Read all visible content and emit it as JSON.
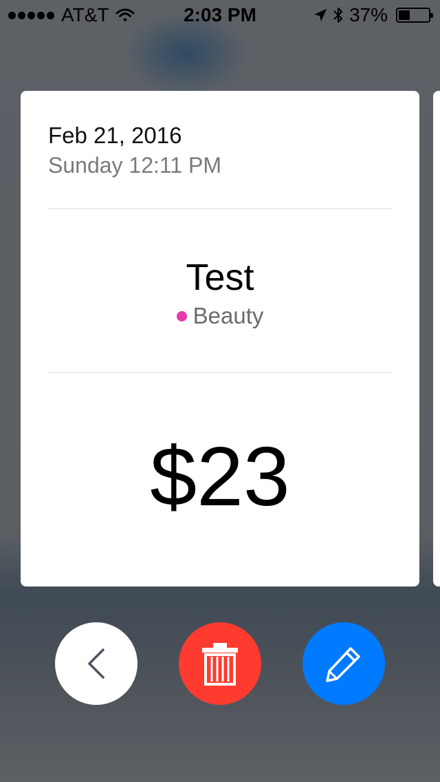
{
  "status_bar": {
    "carrier": "AT&T",
    "time": "2:03 PM",
    "battery": "37%",
    "battery_level": 0.37
  },
  "entry": {
    "date": "Feb 21, 2016",
    "day_time": "Sunday 12:11 PM",
    "title": "Test",
    "category": "Beauty",
    "category_color": "#e83aa8",
    "amount": "$23"
  },
  "actions": {
    "back_icon": "chevron-left-icon",
    "delete_icon": "trash-icon",
    "edit_icon": "pencil-icon",
    "delete_color": "#ff3b30",
    "edit_color": "#007aff"
  }
}
